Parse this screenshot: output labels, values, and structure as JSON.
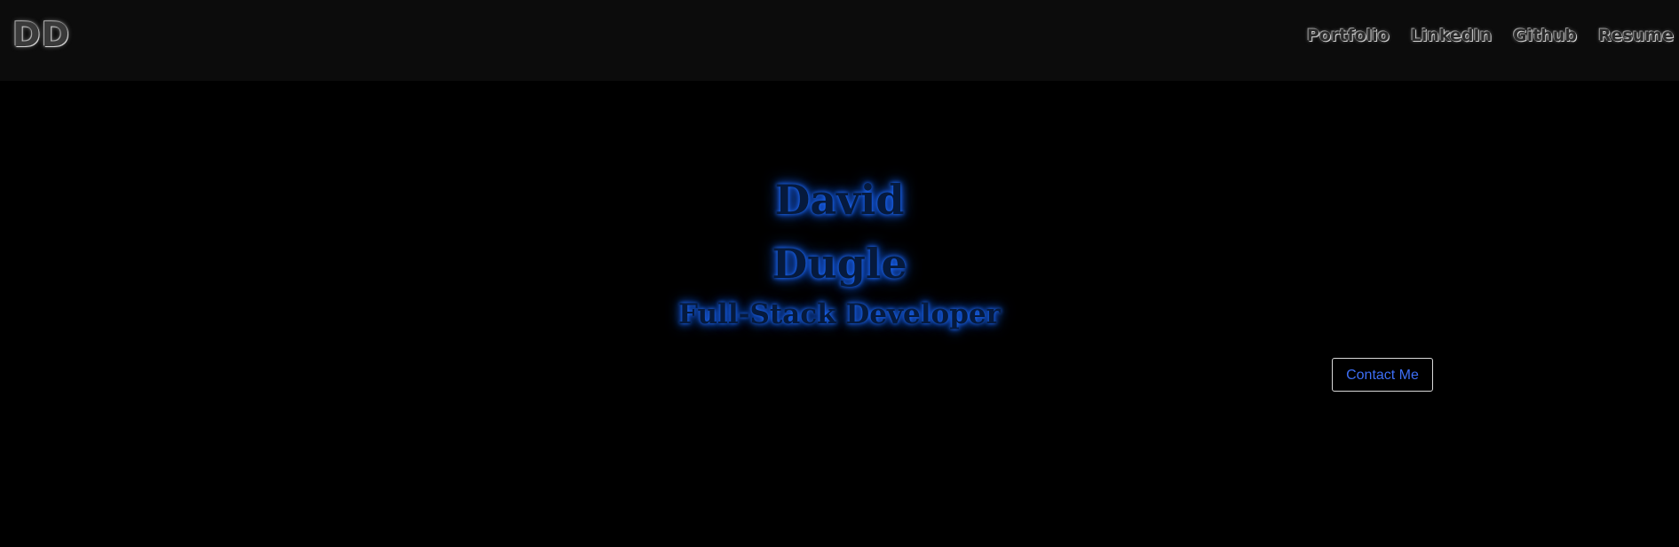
{
  "navbar": {
    "logo": "DD",
    "links": [
      {
        "label": "Portfolio"
      },
      {
        "label": "LinkedIn"
      },
      {
        "label": "Github"
      },
      {
        "label": "Resume"
      }
    ]
  },
  "hero": {
    "first_name": "David",
    "last_name": "Dugle",
    "title": "Full-Stack Developer",
    "contact_button": "Contact Me"
  },
  "colors": {
    "background": "#000000",
    "navbar_background": "#0c0c0c",
    "glow_blue": "#1f6fff",
    "button_text": "#3d6ef5",
    "button_border": "#d9d9d9"
  }
}
